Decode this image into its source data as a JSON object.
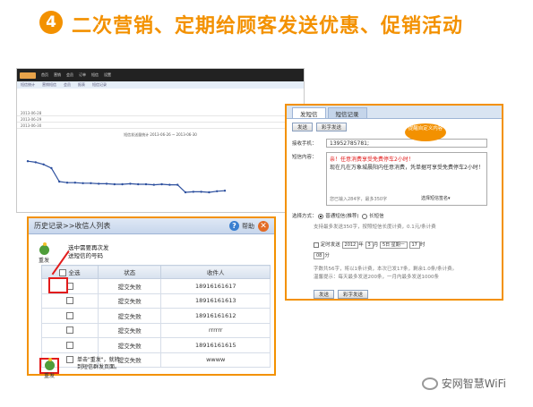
{
  "headline": {
    "number": "4",
    "text": "二次营销、定期给顾客发送优惠、促销活动"
  },
  "dashboard": {
    "nav": [
      "首页",
      "营销",
      "会员",
      "订单",
      "短信",
      "设置"
    ],
    "tabs": [
      "短信统计",
      "营销短信",
      "会员",
      "报表",
      "短信记录"
    ],
    "rows": [
      "2013-06-28",
      "2013-06-29",
      "2013-06-30"
    ],
    "chart_title": "短信发送量统计 2013-06-26 ~ 2013-06-30"
  },
  "back_list": {
    "title": "历史记录>>收信人列表",
    "help_label": "帮助",
    "help_glyph": "?",
    "close_glyph": "✕",
    "resend_label": "重发",
    "note_top": [
      "选中需要再次发",
      "送短信的号码"
    ],
    "columns": [
      "全选",
      "状态",
      "收件人"
    ],
    "rows": [
      {
        "status": "提交失败",
        "recipient": "18916161617"
      },
      {
        "status": "提交失败",
        "recipient": "18916161613"
      },
      {
        "status": "提交失败",
        "recipient": "18916161612"
      },
      {
        "status": "提交失败",
        "recipient": "rrrrrr"
      },
      {
        "status": "提交失败",
        "recipient": "18916161615"
      },
      {
        "status": "提交失败",
        "recipient": "wwww"
      }
    ],
    "note_bottom": [
      "单击\"重发\"，就转",
      "到短信群发页面。"
    ]
  },
  "sms": {
    "tabs": [
      "发短信",
      "短信记录"
    ],
    "send_btn": "发送",
    "sendmore_btn": "彩字发送",
    "phone_label": "接收手机：",
    "phone": "13952785781;",
    "content_label": "短信内容：",
    "content_red": "亲！任意消费享受免费停车2小时！",
    "content_black": "现在凡在万象城晨阳内任意消费，凭单据可享受免费停车2小时！",
    "bubble": "提醒自定义内容",
    "count": "您已输入284字，最多350字",
    "sig": "选择短信签名▾",
    "method_label": "选择方式：",
    "radio1": "普通短信(推荐)",
    "radio2": "长短信",
    "mode_note": "支持最多发送350字，按照短信长度计费，0.1元/条计费",
    "timed_label": "定时发送",
    "year": "2012",
    "year_u": "年",
    "month": "3",
    "month_u": "月",
    "day": "5日 星期一",
    "hour": "17",
    "hour_u": "时",
    "minute": "08",
    "minute_u": "分",
    "info1": "字数共56字，将以1条计费，本次已发17条，剩余1.0条/条计费。",
    "info2": "温馨提示：每天最多发送200条，一月内最多发送1000条"
  },
  "watermark": "安网智慧WiFi",
  "chart_data": {
    "type": "line",
    "series": [
      {
        "values": [
          68,
          66,
          62,
          55,
          30,
          28,
          28,
          27,
          27,
          26,
          26,
          25,
          25,
          26,
          25,
          25,
          24,
          25,
          24,
          24,
          10,
          11,
          11,
          10,
          12,
          13
        ]
      }
    ]
  }
}
